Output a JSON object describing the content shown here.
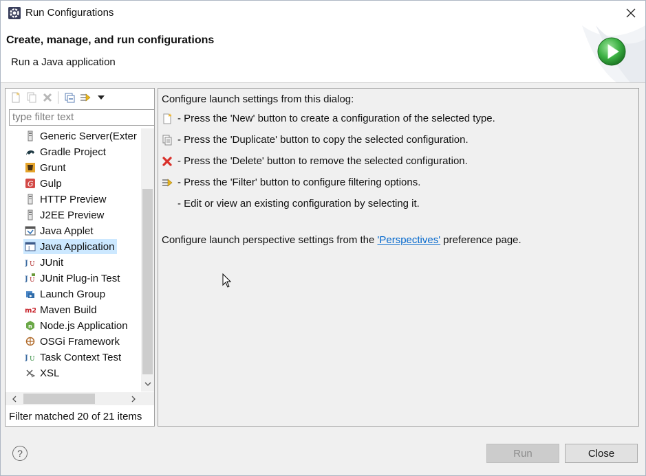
{
  "window": {
    "title": "Run Configurations"
  },
  "header": {
    "title": "Create, manage, and run configurations",
    "subtitle": "Run a Java application"
  },
  "left_panel": {
    "toolbar": [
      "new-config-icon",
      "duplicate-icon",
      "delete-icon",
      "collapse-all-icon",
      "filter-icon",
      "dropdown-arrow-icon"
    ],
    "filter_placeholder": "type filter text",
    "tree_items": [
      {
        "label": "Generic Server(Exter",
        "icon": "server-icon"
      },
      {
        "label": "Gradle Project",
        "icon": "gradle-icon"
      },
      {
        "label": "Grunt",
        "icon": "grunt-icon"
      },
      {
        "label": "Gulp",
        "icon": "gulp-icon"
      },
      {
        "label": "HTTP Preview",
        "icon": "server-icon"
      },
      {
        "label": "J2EE Preview",
        "icon": "server-icon"
      },
      {
        "label": "Java Applet",
        "icon": "applet-icon"
      },
      {
        "label": "Java Application",
        "icon": "java-app-icon",
        "selected": true
      },
      {
        "label": "JUnit",
        "icon": "junit-icon"
      },
      {
        "label": "JUnit Plug-in Test",
        "icon": "junit-plugin-icon"
      },
      {
        "label": "Launch Group",
        "icon": "launch-group-icon"
      },
      {
        "label": "Maven Build",
        "icon": "maven-icon"
      },
      {
        "label": "Node.js Application",
        "icon": "nodejs-icon"
      },
      {
        "label": "OSGi Framework",
        "icon": "osgi-icon"
      },
      {
        "label": "Task Context Test",
        "icon": "task-context-icon"
      },
      {
        "label": "XSL",
        "icon": "xsl-icon"
      }
    ],
    "filter_status": "Filter matched 20 of 21 items"
  },
  "right_panel": {
    "intro": "Configure launch settings from this dialog:",
    "lines": [
      {
        "icon": "new-config-icon",
        "text": "- Press the 'New' button to create a configuration of the selected type."
      },
      {
        "icon": "duplicate-icon",
        "text": "- Press the 'Duplicate' button to copy the selected configuration."
      },
      {
        "icon": "delete-icon",
        "text": "- Press the 'Delete' button to remove the selected configuration."
      },
      {
        "icon": "filter-icon",
        "text": "- Press the 'Filter' button to configure filtering options."
      },
      {
        "icon": "",
        "text": "- Edit or view an existing configuration by selecting it."
      }
    ],
    "perspective_prefix": "Configure launch perspective settings from the ",
    "perspective_link": "'Perspectives'",
    "perspective_suffix": " preference page."
  },
  "footer": {
    "help_label": "?",
    "run_label": "Run",
    "close_label": "Close"
  },
  "colors": {
    "selection": "#cce8ff",
    "link": "#0066cc",
    "run_green": "#3cb043"
  }
}
